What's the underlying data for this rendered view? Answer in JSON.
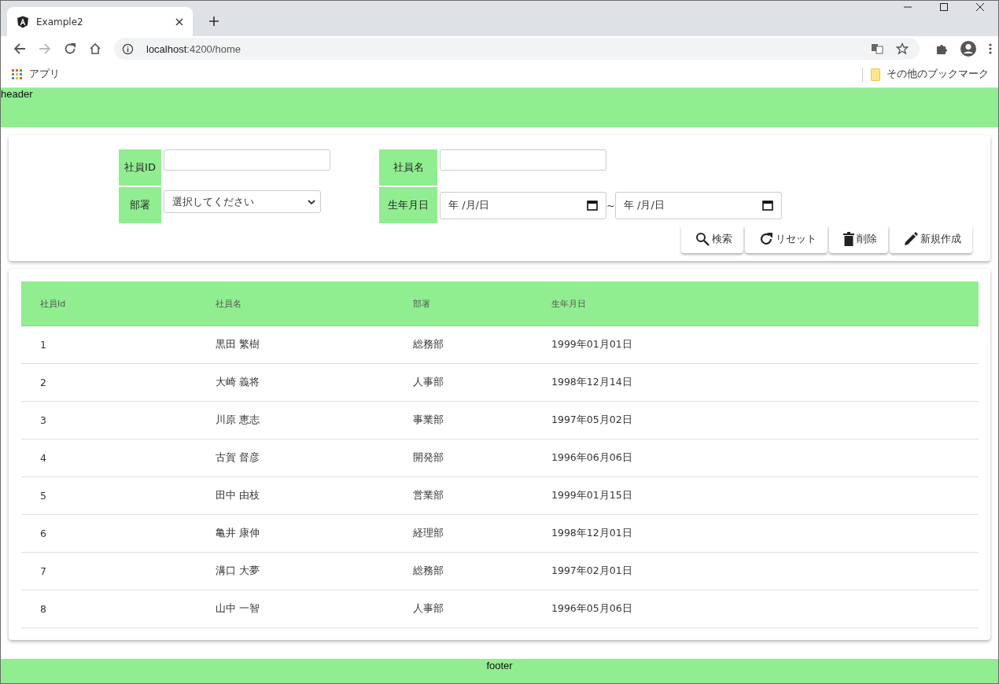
{
  "browser": {
    "tab_title": "Example2",
    "url_host": "localhost",
    "url_rest": ":4200/home",
    "bookmarks_apps": "アプリ",
    "bookmarks_other": "その他のブックマーク"
  },
  "header": {
    "text": "header"
  },
  "form": {
    "fields": [
      {
        "label": "社員ID",
        "kind": "text"
      },
      {
        "label": "社員名",
        "kind": "text"
      },
      {
        "label": "部署",
        "kind": "select",
        "value": "選択してください"
      },
      {
        "label": "生年月日",
        "kind": "daterange",
        "from": "年 /月/日",
        "separator": "~",
        "to": "年 /月/日"
      }
    ],
    "buttons": [
      {
        "label": "検索",
        "kind": "search"
      },
      {
        "label": "リセット",
        "kind": "reset"
      },
      {
        "label": "削除",
        "kind": "delete"
      },
      {
        "label": "新規作成",
        "kind": "create"
      }
    ]
  },
  "table": {
    "columns": [
      "社員Id",
      "社員名",
      "部署",
      "生年月日"
    ],
    "rows": [
      [
        "1",
        "黒田 繁樹",
        "総務部",
        "1999年01月01日"
      ],
      [
        "2",
        "大崎 義将",
        "人事部",
        "1998年12月14日"
      ],
      [
        "3",
        "川原 恵志",
        "事業部",
        "1997年05月02日"
      ],
      [
        "4",
        "古賀 督彦",
        "開発部",
        "1996年06月06日"
      ],
      [
        "5",
        "田中 由枝",
        "営業部",
        "1999年01月15日"
      ],
      [
        "6",
        "亀井 康伸",
        "経理部",
        "1998年12月01日"
      ],
      [
        "7",
        "溝口 大夢",
        "総務部",
        "1997年02月01日"
      ],
      [
        "8",
        "山中 一智",
        "人事部",
        "1996年05月06日"
      ]
    ]
  },
  "footer": {
    "text": "footer"
  }
}
